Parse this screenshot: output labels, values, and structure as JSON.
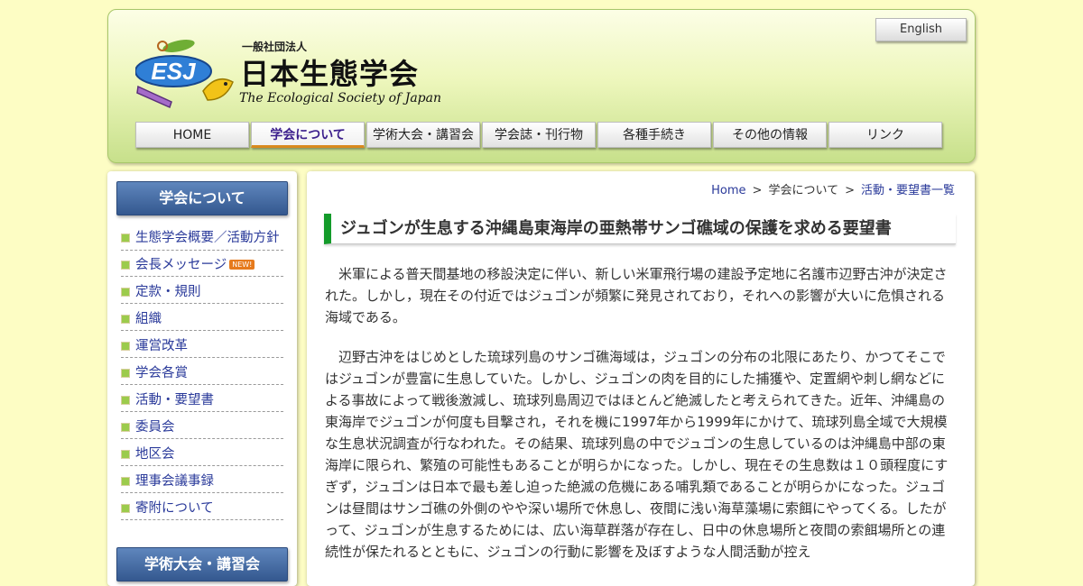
{
  "header": {
    "org_type": "一般社団法人",
    "org_name": "日本生態学会",
    "org_name_en": "The Ecological Society of Japan",
    "logo_letters": "ESJ",
    "lang_button": "English"
  },
  "nav": {
    "items": [
      {
        "label": "HOME"
      },
      {
        "label": "学会について"
      },
      {
        "label": "学術大会・講習会"
      },
      {
        "label": "学会誌・刊行物"
      },
      {
        "label": "各種手続き"
      },
      {
        "label": "その他の情報"
      },
      {
        "label": "リンク"
      }
    ],
    "active_index": 1
  },
  "sidebar": {
    "heading": "学会について",
    "new_badge": "NEW!",
    "items": [
      {
        "label": "生態学会概要／活動方針"
      },
      {
        "label": "会長メッセージ"
      },
      {
        "label": "定款・規則"
      },
      {
        "label": "組織"
      },
      {
        "label": "運営改革"
      },
      {
        "label": "学会各賞"
      },
      {
        "label": "活動・要望書"
      },
      {
        "label": "委員会"
      },
      {
        "label": "地区会"
      },
      {
        "label": "理事会議事録"
      },
      {
        "label": "寄附について"
      }
    ],
    "heading2": "学術大会・講習会"
  },
  "breadcrumb": {
    "home": "Home",
    "sep": ">",
    "mid": "学会について",
    "current": "活動・要望書一覧"
  },
  "article": {
    "title": "ジュゴンが生息する沖縄島東海岸の亜熱帯サンゴ礁域の保護を求める要望書",
    "paragraphs": [
      "米軍による普天間基地の移設決定に伴い、新しい米軍飛行場の建設予定地に名護市辺野古沖が決定された。しかし，現在その付近ではジュゴンが頻繁に発見されており，それへの影響が大いに危惧される海域である。",
      "辺野古沖をはじめとした琉球列島のサンゴ礁海域は，ジュゴンの分布の北限にあたり、かつてそこではジュゴンが豊富に生息していた。しかし、ジュゴンの肉を目的にした捕獲や、定置網や刺し網などによる事故によって戦後激減し、琉球列島周辺ではほとんど絶滅したと考えられてきた。近年、沖縄島の東海岸でジュゴンが何度も目撃され，それを機に1997年から1999年にかけて、琉球列島全域で大規模な生息状況調査が行なわれた。その結果、琉球列島の中でジュゴンの生息しているのは沖縄島中部の東海岸に限られ、繁殖の可能性もあることが明らかになった。しかし、現在その生息数は１０頭程度にすぎず，ジュゴンは日本で最も差し迫った絶滅の危機にある哺乳類であることが明らかになった。ジュゴンは昼間はサンゴ礁の外側のやや深い場所で休息し、夜間に浅い海草藻場に索餌にやってくる。したがって、ジュゴンが生息するためには、広い海草群落が存在し、日中の休息場所と夜間の索餌場所との連続性が保たれるとともに、ジュゴンの行動に影響を及ぼすような人間活動が控え"
    ]
  }
}
